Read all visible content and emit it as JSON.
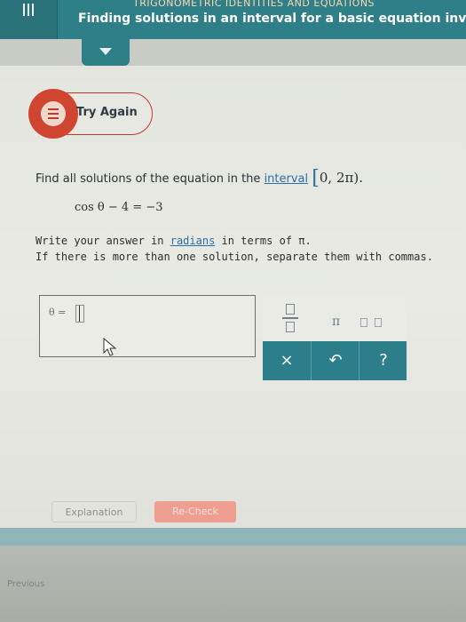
{
  "header": {
    "section_label": "TRIGONOMETRIC IDENTITIES AND EQUATIONS",
    "title": "Finding solutions in an interval for a basic equation involving"
  },
  "feedback": {
    "label": "Try Again"
  },
  "question": {
    "prompt": "Find all solutions of the equation in the",
    "interval_link": "interval",
    "interval_value": "0, 2π).",
    "equation": "cos θ − 4 = −3",
    "instruction_prefix": "Write your answer in",
    "radians_link": "radians",
    "instruction_suffix": "in terms of π.",
    "instruction_line2": "If there is more than one solution, separate them with commas."
  },
  "answer": {
    "label": "θ ="
  },
  "keypad": {
    "pi": "π",
    "clear": "×",
    "undo": "↶",
    "help": "?"
  },
  "actions": {
    "explanation": "Explanation",
    "recheck": "Re-Check"
  },
  "footer": {
    "previous": "Previous"
  },
  "colors": {
    "header": "#2f7f88",
    "error": "#d0452f",
    "link": "#2a6fa3",
    "recheck": "#ef9e92"
  }
}
